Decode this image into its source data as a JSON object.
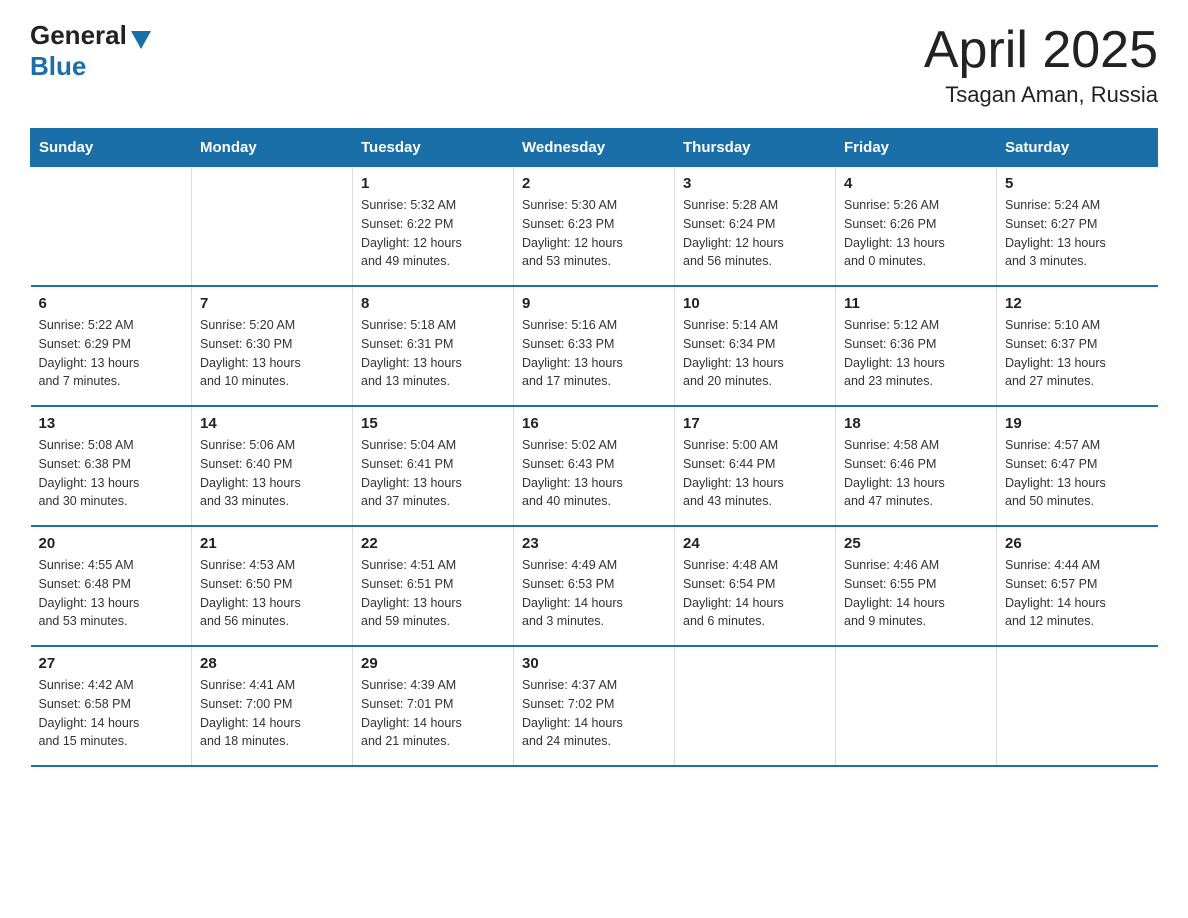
{
  "header": {
    "logo": {
      "general": "General",
      "blue": "Blue"
    },
    "title": "April 2025",
    "subtitle": "Tsagan Aman, Russia"
  },
  "columns": [
    "Sunday",
    "Monday",
    "Tuesday",
    "Wednesday",
    "Thursday",
    "Friday",
    "Saturday"
  ],
  "weeks": [
    [
      {
        "day": "",
        "info": ""
      },
      {
        "day": "",
        "info": ""
      },
      {
        "day": "1",
        "info": "Sunrise: 5:32 AM\nSunset: 6:22 PM\nDaylight: 12 hours\nand 49 minutes."
      },
      {
        "day": "2",
        "info": "Sunrise: 5:30 AM\nSunset: 6:23 PM\nDaylight: 12 hours\nand 53 minutes."
      },
      {
        "day": "3",
        "info": "Sunrise: 5:28 AM\nSunset: 6:24 PM\nDaylight: 12 hours\nand 56 minutes."
      },
      {
        "day": "4",
        "info": "Sunrise: 5:26 AM\nSunset: 6:26 PM\nDaylight: 13 hours\nand 0 minutes."
      },
      {
        "day": "5",
        "info": "Sunrise: 5:24 AM\nSunset: 6:27 PM\nDaylight: 13 hours\nand 3 minutes."
      }
    ],
    [
      {
        "day": "6",
        "info": "Sunrise: 5:22 AM\nSunset: 6:29 PM\nDaylight: 13 hours\nand 7 minutes."
      },
      {
        "day": "7",
        "info": "Sunrise: 5:20 AM\nSunset: 6:30 PM\nDaylight: 13 hours\nand 10 minutes."
      },
      {
        "day": "8",
        "info": "Sunrise: 5:18 AM\nSunset: 6:31 PM\nDaylight: 13 hours\nand 13 minutes."
      },
      {
        "day": "9",
        "info": "Sunrise: 5:16 AM\nSunset: 6:33 PM\nDaylight: 13 hours\nand 17 minutes."
      },
      {
        "day": "10",
        "info": "Sunrise: 5:14 AM\nSunset: 6:34 PM\nDaylight: 13 hours\nand 20 minutes."
      },
      {
        "day": "11",
        "info": "Sunrise: 5:12 AM\nSunset: 6:36 PM\nDaylight: 13 hours\nand 23 minutes."
      },
      {
        "day": "12",
        "info": "Sunrise: 5:10 AM\nSunset: 6:37 PM\nDaylight: 13 hours\nand 27 minutes."
      }
    ],
    [
      {
        "day": "13",
        "info": "Sunrise: 5:08 AM\nSunset: 6:38 PM\nDaylight: 13 hours\nand 30 minutes."
      },
      {
        "day": "14",
        "info": "Sunrise: 5:06 AM\nSunset: 6:40 PM\nDaylight: 13 hours\nand 33 minutes."
      },
      {
        "day": "15",
        "info": "Sunrise: 5:04 AM\nSunset: 6:41 PM\nDaylight: 13 hours\nand 37 minutes."
      },
      {
        "day": "16",
        "info": "Sunrise: 5:02 AM\nSunset: 6:43 PM\nDaylight: 13 hours\nand 40 minutes."
      },
      {
        "day": "17",
        "info": "Sunrise: 5:00 AM\nSunset: 6:44 PM\nDaylight: 13 hours\nand 43 minutes."
      },
      {
        "day": "18",
        "info": "Sunrise: 4:58 AM\nSunset: 6:46 PM\nDaylight: 13 hours\nand 47 minutes."
      },
      {
        "day": "19",
        "info": "Sunrise: 4:57 AM\nSunset: 6:47 PM\nDaylight: 13 hours\nand 50 minutes."
      }
    ],
    [
      {
        "day": "20",
        "info": "Sunrise: 4:55 AM\nSunset: 6:48 PM\nDaylight: 13 hours\nand 53 minutes."
      },
      {
        "day": "21",
        "info": "Sunrise: 4:53 AM\nSunset: 6:50 PM\nDaylight: 13 hours\nand 56 minutes."
      },
      {
        "day": "22",
        "info": "Sunrise: 4:51 AM\nSunset: 6:51 PM\nDaylight: 13 hours\nand 59 minutes."
      },
      {
        "day": "23",
        "info": "Sunrise: 4:49 AM\nSunset: 6:53 PM\nDaylight: 14 hours\nand 3 minutes."
      },
      {
        "day": "24",
        "info": "Sunrise: 4:48 AM\nSunset: 6:54 PM\nDaylight: 14 hours\nand 6 minutes."
      },
      {
        "day": "25",
        "info": "Sunrise: 4:46 AM\nSunset: 6:55 PM\nDaylight: 14 hours\nand 9 minutes."
      },
      {
        "day": "26",
        "info": "Sunrise: 4:44 AM\nSunset: 6:57 PM\nDaylight: 14 hours\nand 12 minutes."
      }
    ],
    [
      {
        "day": "27",
        "info": "Sunrise: 4:42 AM\nSunset: 6:58 PM\nDaylight: 14 hours\nand 15 minutes."
      },
      {
        "day": "28",
        "info": "Sunrise: 4:41 AM\nSunset: 7:00 PM\nDaylight: 14 hours\nand 18 minutes."
      },
      {
        "day": "29",
        "info": "Sunrise: 4:39 AM\nSunset: 7:01 PM\nDaylight: 14 hours\nand 21 minutes."
      },
      {
        "day": "30",
        "info": "Sunrise: 4:37 AM\nSunset: 7:02 PM\nDaylight: 14 hours\nand 24 minutes."
      },
      {
        "day": "",
        "info": ""
      },
      {
        "day": "",
        "info": ""
      },
      {
        "day": "",
        "info": ""
      }
    ]
  ]
}
